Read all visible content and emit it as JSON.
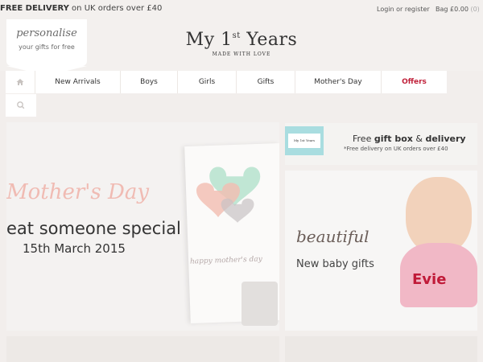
{
  "topbar": {
    "promo_bold": "FREE DELIVERY",
    "promo_rest": " on UK orders over £40",
    "account_link": "Login or register",
    "bag_label": "Bag £0.00",
    "bag_count": "(0)"
  },
  "header": {
    "badge_script": "personalise",
    "badge_sub": "your gifts for free",
    "logo_name": "My 1",
    "logo_sup": "st",
    "logo_name_end": " Years",
    "logo_tagline": "MADE WITH LOVE"
  },
  "nav": {
    "home_icon": "home-icon",
    "search_icon": "search-icon",
    "items": [
      {
        "label": "New Arrivals"
      },
      {
        "label": "Boys"
      },
      {
        "label": "Girls"
      },
      {
        "label": "Gifts"
      },
      {
        "label": "Mother's Day"
      },
      {
        "label": "Offers"
      }
    ]
  },
  "hero": {
    "script_text": "Mother's Day",
    "headline": "eat someone special",
    "date": "15th March 2015",
    "card_script": "happy mother's day"
  },
  "promo_delivery": {
    "box_text": "My 1st Years",
    "title_pre": "Free ",
    "title_bold": "gift box",
    "title_mid": " & ",
    "title_bold2": "delivery",
    "note": "*Free delivery on UK orders over £40"
  },
  "baby_promo": {
    "script_text": "beautiful",
    "subtitle": "New baby gifts",
    "bib_name": "Evie"
  },
  "colors": {
    "accent_red": "#c0213a",
    "page_bg": "#f2eeec",
    "heart_green": "#b9e3cf",
    "heart_pink": "#f3bdb0",
    "gift_box": "#a9dde0"
  }
}
